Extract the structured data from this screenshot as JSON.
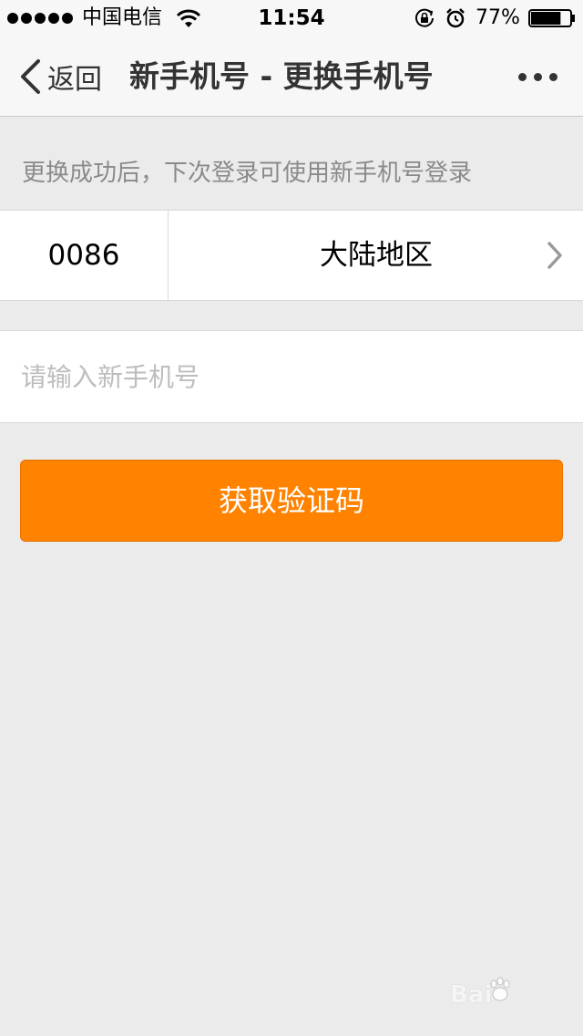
{
  "status_bar": {
    "carrier": "中国电信",
    "time": "11:54",
    "battery_percent": "77%",
    "battery_level": 0.77,
    "signal_dots": 5,
    "icons": [
      "signal-dots-icon",
      "wifi-icon",
      "rotation-lock-icon",
      "alarm-icon",
      "battery-icon"
    ]
  },
  "nav": {
    "back_label": "返回",
    "title": "新手机号 - 更换手机号",
    "icons": [
      "chevron-left-icon",
      "more-icon"
    ]
  },
  "hint": "更换成功后，下次登录可使用新手机号登录",
  "region_row": {
    "code": "0086",
    "region": "大陆地区",
    "icon": "chevron-right-icon"
  },
  "phone_input": {
    "value": "",
    "placeholder": "请输入新手机号"
  },
  "submit_button": {
    "label": "获取验证码",
    "color": "#ff8200"
  },
  "watermark": {
    "brand": "Bai",
    "icon": "baidu-paw-icon"
  }
}
